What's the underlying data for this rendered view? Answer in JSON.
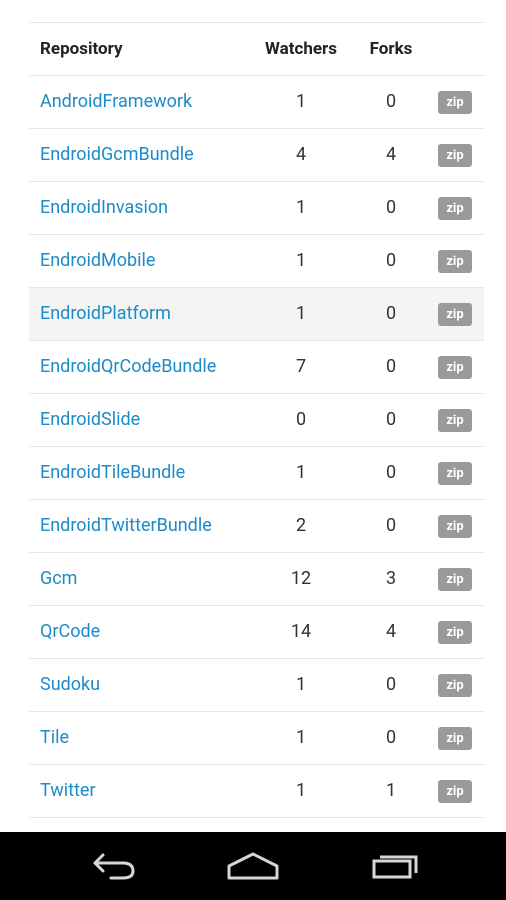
{
  "table": {
    "headers": {
      "repository": "Repository",
      "watchers": "Watchers",
      "forks": "Forks"
    },
    "rows": [
      {
        "name": "AndroidFramework",
        "watchers": "1",
        "forks": "0",
        "zip": "zip"
      },
      {
        "name": "EndroidGcmBundle",
        "watchers": "4",
        "forks": "4",
        "zip": "zip"
      },
      {
        "name": "EndroidInvasion",
        "watchers": "1",
        "forks": "0",
        "zip": "zip"
      },
      {
        "name": "EndroidMobile",
        "watchers": "1",
        "forks": "0",
        "zip": "zip"
      },
      {
        "name": "EndroidPlatform",
        "watchers": "1",
        "forks": "0",
        "zip": "zip"
      },
      {
        "name": "EndroidQrCodeBundle",
        "watchers": "7",
        "forks": "0",
        "zip": "zip"
      },
      {
        "name": "EndroidSlide",
        "watchers": "0",
        "forks": "0",
        "zip": "zip"
      },
      {
        "name": "EndroidTileBundle",
        "watchers": "1",
        "forks": "0",
        "zip": "zip"
      },
      {
        "name": "EndroidTwitterBundle",
        "watchers": "2",
        "forks": "0",
        "zip": "zip"
      },
      {
        "name": "Gcm",
        "watchers": "12",
        "forks": "3",
        "zip": "zip"
      },
      {
        "name": "QrCode",
        "watchers": "14",
        "forks": "4",
        "zip": "zip"
      },
      {
        "name": "Sudoku",
        "watchers": "1",
        "forks": "0",
        "zip": "zip"
      },
      {
        "name": "Tile",
        "watchers": "1",
        "forks": "0",
        "zip": "zip"
      },
      {
        "name": "Twitter",
        "watchers": "1",
        "forks": "1",
        "zip": "zip"
      }
    ]
  },
  "navbar": {
    "back": "back-icon",
    "home": "home-icon",
    "recents": "recents-icon"
  },
  "colors": {
    "link": "#1c8bc7",
    "zip_badge": "#9a9a9a",
    "highlight_row": "#f4f4f4",
    "navbar": "#000000"
  }
}
